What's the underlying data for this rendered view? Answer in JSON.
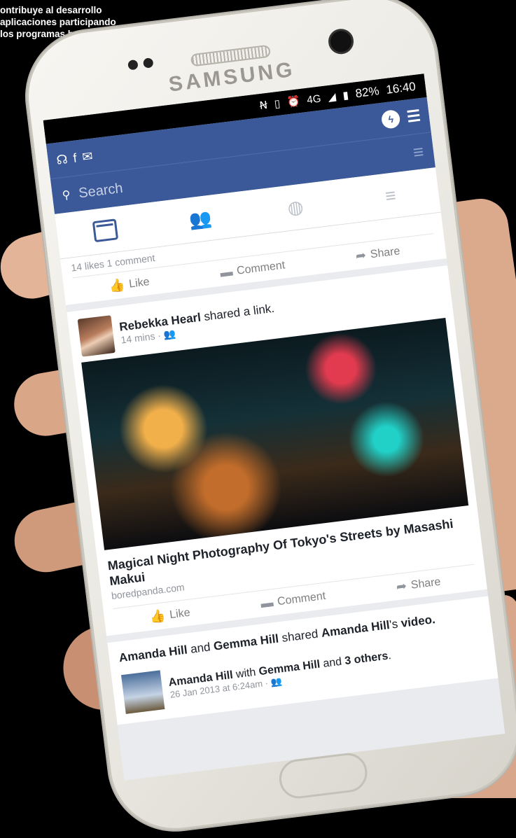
{
  "caption": {
    "lines": [
      "ontribuye al desarrollo",
      "aplicaciones participando",
      "los programas beta"
    ]
  },
  "phone": {
    "brand": "SAMSUNG"
  },
  "status_bar": {
    "icons": [
      "nfc-icon",
      "vibrate-icon",
      "alarm-icon",
      "4g-icon",
      "signal-icon",
      "battery-icon"
    ],
    "network": "4G",
    "battery": "82%",
    "time": "16:40"
  },
  "app_bar": {
    "left_icons": [
      "headphones-icon",
      "facebook-icon",
      "mail-icon"
    ],
    "right_icons": [
      "messenger-icon",
      "friend-requests-icon"
    ]
  },
  "search": {
    "placeholder": "Search"
  },
  "tabs": [
    {
      "name": "news-feed-tab",
      "active": true
    },
    {
      "name": "friends-tab",
      "active": false
    },
    {
      "name": "notifications-tab",
      "active": false
    },
    {
      "name": "menu-tab",
      "active": false
    }
  ],
  "post1": {
    "likes": "14 likes",
    "comments": "1 comment",
    "like_label": "Like",
    "comment_label": "Comment",
    "share_label": "Share"
  },
  "post2": {
    "author": "Rebekka Hearl",
    "action": "shared a link.",
    "time": "14 mins",
    "link_title": "Magical Night Photography Of Tokyo's Streets by Masashi Makui",
    "link_domain": "boredpanda.com",
    "like_label": "Like",
    "comment_label": "Comment",
    "share_label": "Share"
  },
  "post3": {
    "actor1": "Amanda Hill",
    "and": "and",
    "actor2": "Gemma Hill",
    "shared": "shared",
    "owner": "Amanda Hill",
    "possessive": "'s",
    "object": "video.",
    "sub_author": "Amanda Hill",
    "sub_with": "with",
    "sub_tagged": "Gemma Hill",
    "sub_and": "and",
    "sub_others": "3 others",
    "sub_meta": "26 Jan 2013 at 6:24am"
  }
}
